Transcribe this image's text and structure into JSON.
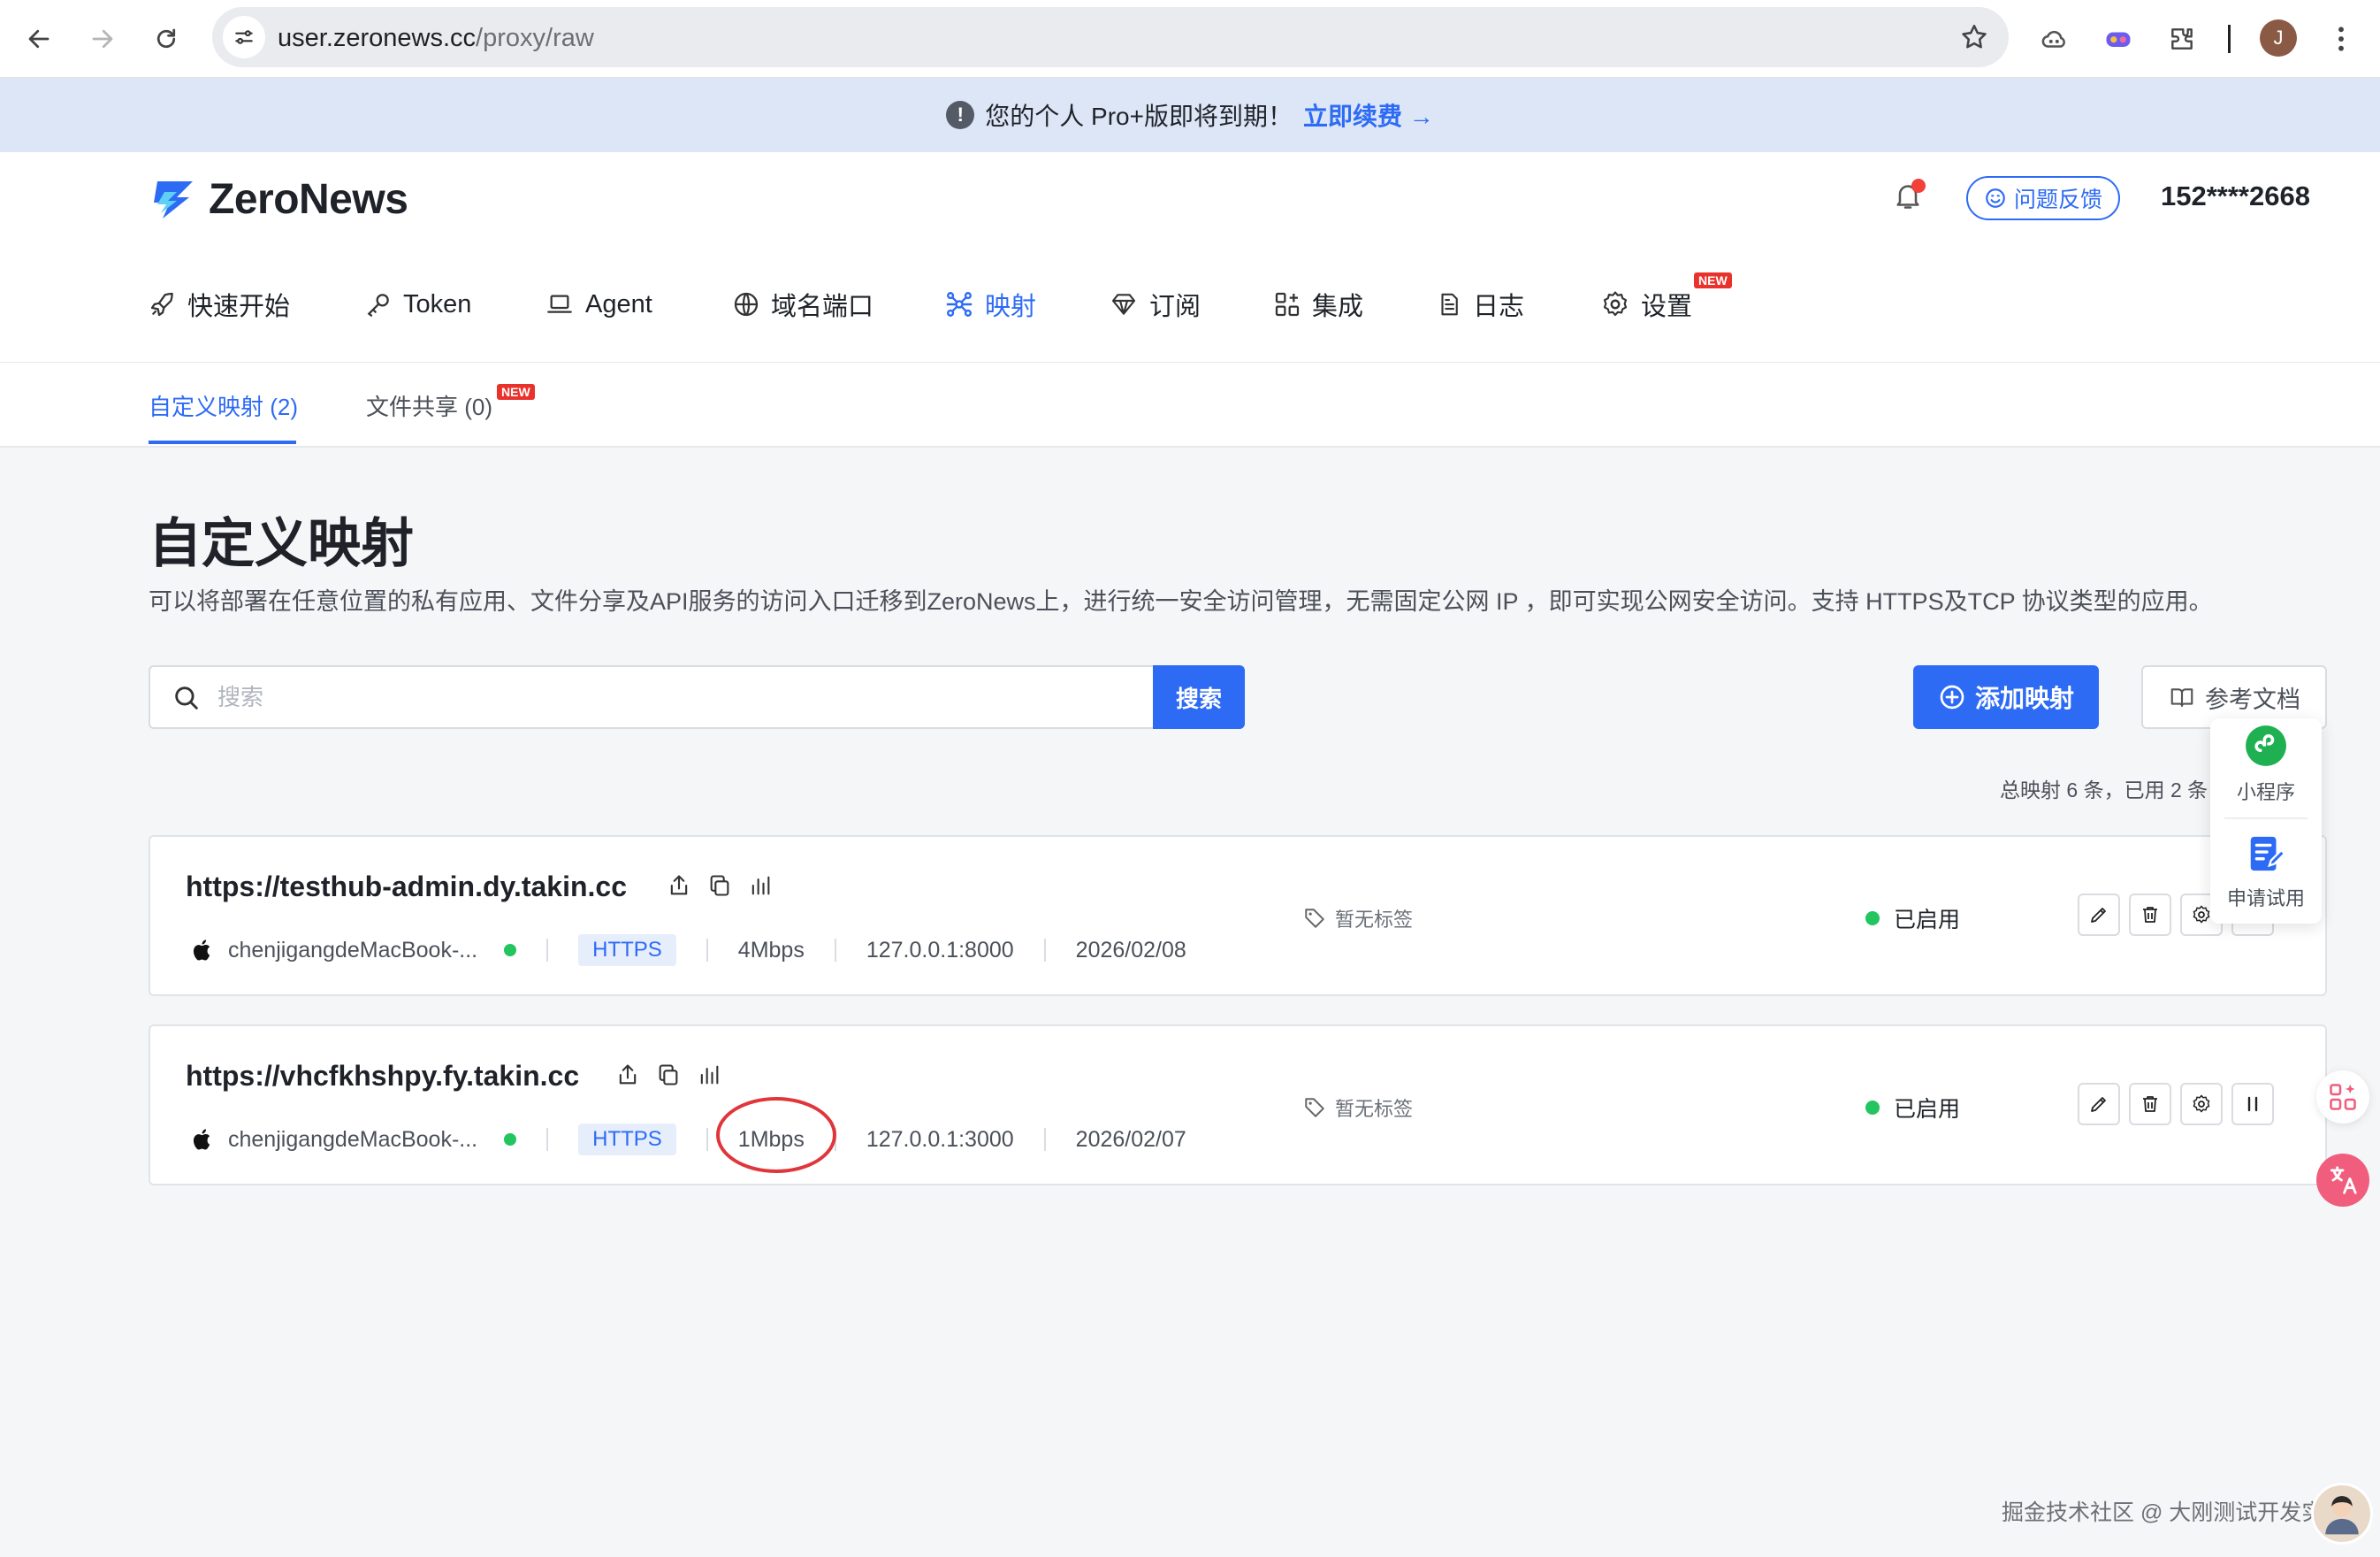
{
  "browser": {
    "url_host": "user.zeronews.cc",
    "url_path": "/proxy/raw",
    "avatar_letter": "J"
  },
  "banner": {
    "message": "您的个人 Pro+版即将到期！",
    "link": "立即续费 →"
  },
  "header": {
    "brand": "ZeroNews",
    "feedback_label": "问题反馈",
    "phone": "152****2668",
    "brand_color": "#2d6bf5"
  },
  "nav": {
    "items": [
      {
        "label": "快速开始",
        "icon": "rocket-icon"
      },
      {
        "label": "Token",
        "icon": "key-icon"
      },
      {
        "label": "Agent",
        "icon": "laptop-icon"
      },
      {
        "label": "域名端口",
        "icon": "globe-icon"
      },
      {
        "label": "映射",
        "icon": "network-icon",
        "active": true
      },
      {
        "label": "订阅",
        "icon": "diamond-icon"
      },
      {
        "label": "集成",
        "icon": "apps-icon"
      },
      {
        "label": "日志",
        "icon": "document-icon"
      },
      {
        "label": "设置",
        "icon": "gear-icon",
        "badge": "NEW"
      }
    ]
  },
  "subtabs": [
    {
      "label": "自定义映射 (2)",
      "active": true
    },
    {
      "label": "文件共享 (0)",
      "badge": "NEW"
    }
  ],
  "page": {
    "title": "自定义映射",
    "description": "可以将部署在任意位置的私有应用、文件分享及API服务的访问入口迁移到ZeroNews上，进行统一安全访问管理，无需固定公网 IP ，即可实现公网安全访问。支持 HTTPS及TCP 协议类型的应用。"
  },
  "toolbar": {
    "search_placeholder": "搜索",
    "search_label": "搜索",
    "add_label": "添加映射",
    "docs_label": "参考文档",
    "summary": "总映射 6 条，已用 2 条"
  },
  "mappings": [
    {
      "url": "https://testhub-admin.dy.takin.cc",
      "agent": "chenjigangdeMacBook-...",
      "protocol": "HTTPS",
      "bandwidth": "4Mbps",
      "local": "127.0.0.1:8000",
      "date": "2026/02/08",
      "tag": "暂无标签",
      "status": "已启用"
    },
    {
      "url": "https://vhcfkhshpy.fy.takin.cc",
      "agent": "chenjigangdeMacBook-...",
      "protocol": "HTTPS",
      "bandwidth": "1Mbps",
      "local": "127.0.0.1:3000",
      "date": "2026/02/07",
      "tag": "暂无标签",
      "status": "已启用"
    }
  ],
  "float_panel": {
    "mini_program": "小程序",
    "trial": "申请试用"
  },
  "watermark": "掘金技术社区 @ 大刚测试开发实战"
}
